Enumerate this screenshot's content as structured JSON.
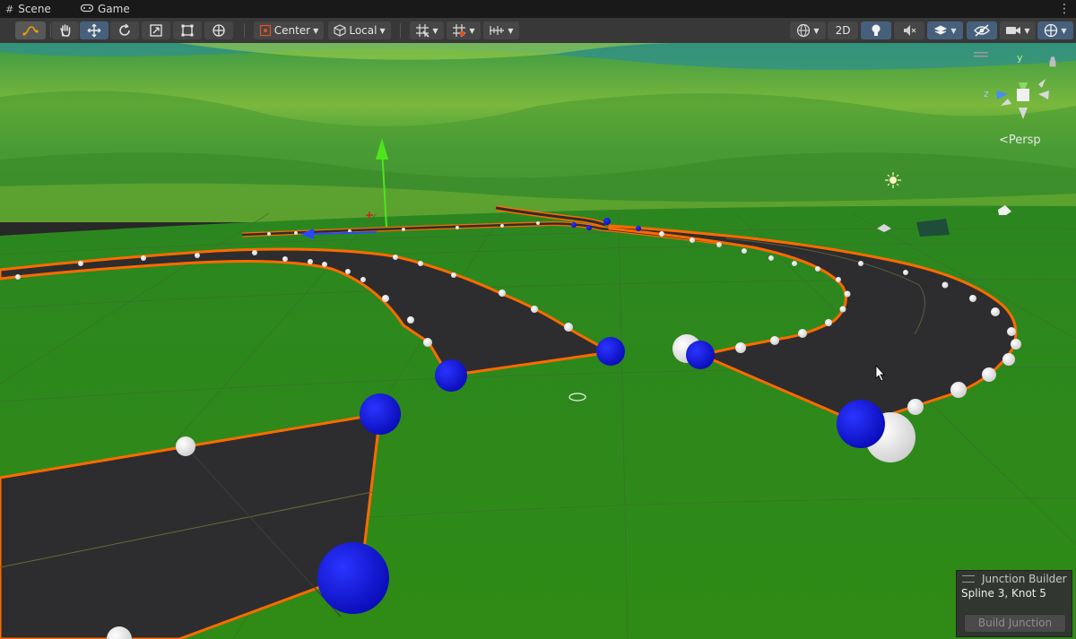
{
  "tabs": [
    {
      "label": "Scene",
      "icon": "grid-icon"
    },
    {
      "label": "Game",
      "icon": "gamepad-icon"
    }
  ],
  "toolbar": {
    "pivot_mode": "Center",
    "pivot_rotation": "Local",
    "mode_2d": "2D"
  },
  "viewport": {
    "projection_label": "Persp",
    "axis_labels": {
      "y": "y",
      "z": "z"
    }
  },
  "overlay": {
    "title": "Junction Builder",
    "selection": "Spline 3, Knot 5",
    "button_label": "Build Junction"
  },
  "colors": {
    "spline_outline": "#ff6a00",
    "road_surface": "#2d2d2f",
    "knot": "#0b10e0",
    "ground": "#2f8418",
    "active_tool": "#46607c"
  }
}
